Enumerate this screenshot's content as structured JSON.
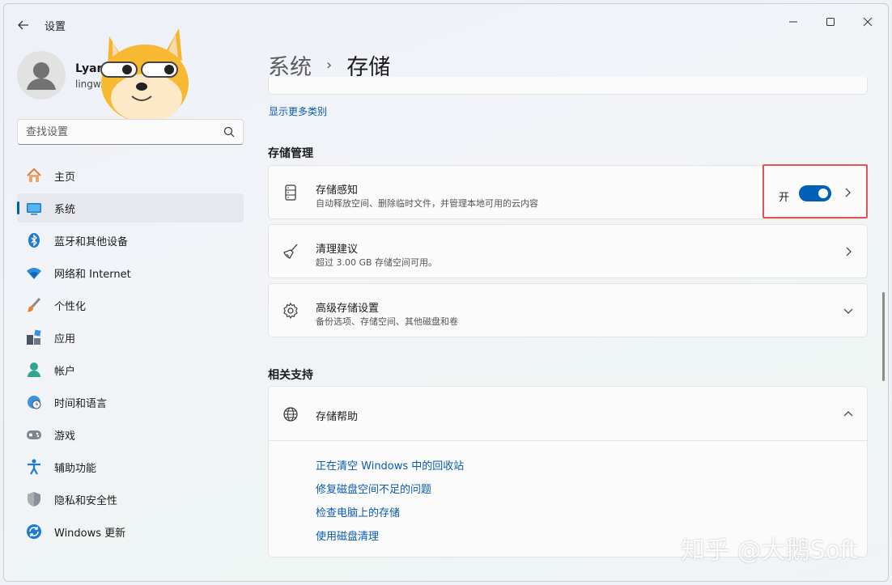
{
  "window": {
    "title": "设置"
  },
  "profile": {
    "name": "Lyan",
    "email": "lingw...om"
  },
  "search": {
    "placeholder": "查找设置"
  },
  "sidebar": {
    "items": [
      {
        "label": "主页",
        "icon": "home-icon"
      },
      {
        "label": "系统",
        "icon": "system-icon",
        "active": true
      },
      {
        "label": "蓝牙和其他设备",
        "icon": "bluetooth-icon"
      },
      {
        "label": "网络和 Internet",
        "icon": "wifi-icon"
      },
      {
        "label": "个性化",
        "icon": "brush-icon"
      },
      {
        "label": "应用",
        "icon": "apps-icon"
      },
      {
        "label": "帐户",
        "icon": "account-icon"
      },
      {
        "label": "时间和语言",
        "icon": "globe-clock-icon"
      },
      {
        "label": "游戏",
        "icon": "gamepad-icon"
      },
      {
        "label": "辅助功能",
        "icon": "accessibility-icon"
      },
      {
        "label": "隐私和安全性",
        "icon": "shield-icon"
      },
      {
        "label": "Windows 更新",
        "icon": "update-icon"
      }
    ]
  },
  "main": {
    "breadcrumb": {
      "parent": "系统",
      "separator": "›",
      "current": "存储"
    },
    "more_categories": "显示更多类别",
    "storage_management": {
      "title": "存储管理",
      "storage_sense": {
        "title": "存储感知",
        "desc": "自动释放空间、删除临时文件，并管理本地可用的云内容",
        "toggle_label": "开",
        "toggle_on": true
      },
      "cleanup": {
        "title": "清理建议",
        "desc": "超过 3.00 GB 存储空间可用。"
      },
      "advanced": {
        "title": "高级存储设置",
        "desc": "备份选项、存储空间、其他磁盘和卷"
      }
    },
    "related_support": {
      "title": "相关支持",
      "help": {
        "title": "存储帮助",
        "links": [
          "正在清空 Windows 中的回收站",
          "修复磁盘空间不足的问题",
          "检查电脑上的存储",
          "使用磁盘清理"
        ]
      }
    }
  },
  "watermark": "知乎 @大鹅Soft",
  "colors": {
    "accent": "#005fb8",
    "link": "#0a5ab0",
    "highlight": "#e05454"
  }
}
